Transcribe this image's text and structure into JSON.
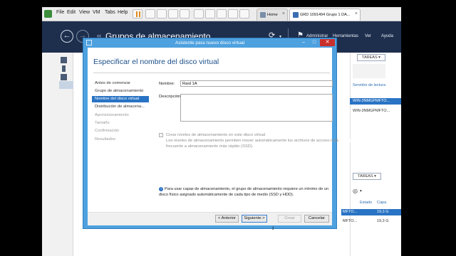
{
  "vmware": {
    "menu": [
      "File",
      "Edit",
      "View",
      "VM",
      "Tabs",
      "Help"
    ],
    "tabs": [
      {
        "label": "Home"
      },
      {
        "label": "GRD 1091494 Grupo 1 DA..."
      }
    ]
  },
  "server_manager": {
    "back_glyph": "←",
    "forward_glyph": "→",
    "title_chevron": "‹‹",
    "title": "Grupos de almacenamiento",
    "refresh_glyph": "⟳",
    "menu": [
      "Administrar",
      "Herramientas",
      "Ver",
      "Ayuda"
    ]
  },
  "background_panel": {
    "tareas_label": "TAREAS ▾",
    "col_header": "Servidor de lectura",
    "rows": [
      "WIN-3NMGPMFTO...",
      "WIN-3NMGPMFTO..."
    ],
    "tareas2_label": "TAREAS ▾",
    "estado_label": "Estado",
    "capacidad_label": "Capa",
    "disk_rows": [
      {
        "name": "MFTO...",
        "size": "19,3 G"
      },
      {
        "name": "MFTO...",
        "size": "19,3 G"
      }
    ]
  },
  "dialog": {
    "title": "Asistente para nuevo disco virtual",
    "heading": "Especificar el nombre del disco virtual",
    "steps": [
      {
        "label": "Antes de comenzar",
        "state": "done"
      },
      {
        "label": "Grupo de almacenamiento",
        "state": "done"
      },
      {
        "label": "Nombre del disco virtual",
        "state": "selected"
      },
      {
        "label": "Distribución de almacena...",
        "state": "done"
      },
      {
        "label": "Aprovisionamiento",
        "state": "disabled"
      },
      {
        "label": "Tamaño",
        "state": "disabled"
      },
      {
        "label": "Confirmación",
        "state": "disabled"
      },
      {
        "label": "Resultados",
        "state": "disabled"
      }
    ],
    "name_label": "Nombre:",
    "name_value": "Raid 1A",
    "description_label": "Descripción:",
    "description_value": "",
    "tiers_checkbox_label": "Crear niveles de almacenamiento en este disco virtual",
    "tiers_help_1": "Los niveles de almacenamiento permiten mover automáticamente los archivos de acceso más",
    "tiers_help_2": "frecuente a almacenamiento más rápido (SSD).",
    "info_1": "Para usar capas de almacenamiento, el grupo de almacenamiento requiere un mínimo de un",
    "info_2": "disco físico asignado automáticamente de cada tipo de medio (SSD y HDD).",
    "buttons": {
      "previous": "< Anterior",
      "next": "Siguiente >",
      "create": "Crear",
      "cancel": "Cancelar"
    },
    "window_buttons": {
      "minimize": "–",
      "maximize": "□",
      "close": "✕"
    }
  },
  "colors": {
    "header_bg": "#1e2f4e",
    "dialog_frame": "#4ea1df",
    "selected_step": "#2973c4",
    "heading_text": "#1b4f8a",
    "close_button": "#c9302c"
  }
}
